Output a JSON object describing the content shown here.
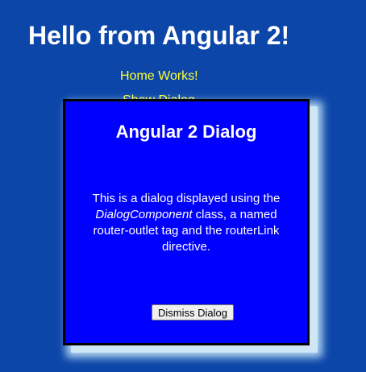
{
  "page": {
    "title": "Hello from Angular 2!"
  },
  "home": {
    "text": "Home Works!",
    "partially_hidden_link": "Show Dialog"
  },
  "dialog": {
    "title": "Angular 2 Dialog",
    "body_part1": "This is a dialog displayed using the ",
    "body_em": "DialogComponent",
    "body_part2": " class, a named router-outlet tag and the routerLink directive.",
    "dismiss_label": "Dismiss Dialog"
  },
  "colors": {
    "background": "#0b46a8",
    "title": "#ffffff",
    "home_text": "#ffff33",
    "dialog_background": "#0000ff",
    "dialog_border": "#000000",
    "dialog_shadow": "#cfe6f5"
  }
}
